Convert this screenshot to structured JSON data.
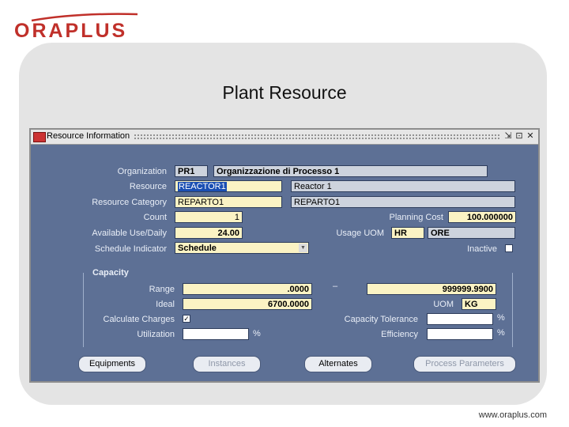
{
  "brand": {
    "logo": "ORAPLUS",
    "accent": "#c0302a"
  },
  "slide": {
    "title": "Plant Resource",
    "footer": "www.oraplus.com"
  },
  "window": {
    "title": "Resource Information",
    "controls": {
      "minimize": "⇲",
      "maximize": "⊡",
      "close": "✕"
    }
  },
  "form": {
    "organization_label": "Organization",
    "organization_code": "PR1",
    "organization_name": "Organizzazione di Processo 1",
    "resource_label": "Resource",
    "resource_code": "REACTOR1",
    "resource_desc": "Reactor 1",
    "category_label": "Resource Category",
    "category_code": "REPARTO1",
    "category_desc": "REPARTO1",
    "count_label": "Count",
    "count_value": "1",
    "planning_cost_label": "Planning Cost",
    "planning_cost_value": "100.000000",
    "available_label": "Available Use/Daily",
    "available_value": "24.00",
    "usage_uom_label": "Usage UOM",
    "usage_uom_code": "HR",
    "usage_uom_desc": "ORE",
    "schedule_label": "Schedule Indicator",
    "schedule_value": "Schedule",
    "inactive_label": "Inactive"
  },
  "capacity": {
    "section_label": "Capacity",
    "range_label": "Range",
    "range_min": ".0000",
    "range_dash": "–",
    "range_max": "999999.9900",
    "ideal_label": "Ideal",
    "ideal_value": "6700.0000",
    "uom_label": "UOM",
    "uom_value": "KG",
    "calc_charges_label": "Calculate Charges",
    "calc_charges_checked": "✓",
    "capacity_tolerance_label": "Capacity Tolerance",
    "capacity_tolerance_value": "",
    "utilization_label": "Utilization",
    "utilization_value": "",
    "efficiency_label": "Efficiency",
    "efficiency_value": "",
    "percent": "%"
  },
  "buttons": {
    "equipments": "Equipments",
    "instances": "Instances",
    "alternates": "Alternates",
    "process_parameters": "Process Parameters"
  }
}
